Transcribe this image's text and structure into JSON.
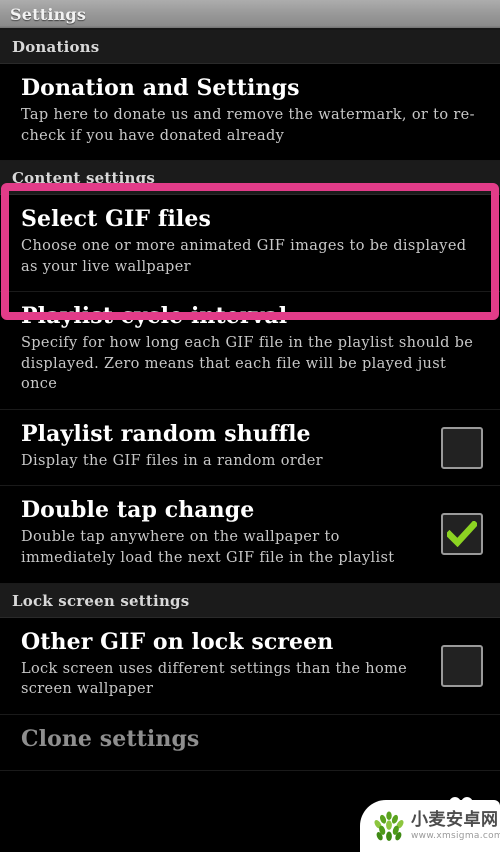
{
  "window": {
    "title": "Settings"
  },
  "colors": {
    "highlight_pink": "#e23c89",
    "checkmark_green": "#8cd322",
    "titlebar_gray": "#9a9a9a",
    "background": "#000000",
    "section_header_bg": "#1b1b1b"
  },
  "sections": [
    {
      "header": "Donations",
      "rows": [
        {
          "title": "Donation and Settings",
          "summary": "Tap here to donate us and remove the watermark, or to re-check if you have donated already",
          "checkbox": null
        }
      ]
    },
    {
      "header": "Content settings",
      "rows": [
        {
          "title": "Select GIF files",
          "summary": "Choose one or more animated GIF images to be displayed as your live wallpaper",
          "checkbox": null
        },
        {
          "title": "Playlist cycle interval",
          "summary": "Specify for how long each GIF file in the playlist should be displayed. Zero means that each file will be played just once",
          "checkbox": null
        },
        {
          "title": "Playlist random shuffle",
          "summary": "Display the GIF files in a random order",
          "checkbox": "unchecked"
        },
        {
          "title": "Double tap change",
          "summary": "Double tap anywhere on the wallpaper to immediately load the next GIF file in the playlist",
          "checkbox": "checked"
        }
      ]
    },
    {
      "header": "Lock screen settings",
      "rows": [
        {
          "title": "Other GIF on lock screen",
          "summary": "Lock screen uses different settings than the home screen wallpaper",
          "checkbox": "unchecked"
        },
        {
          "title": "Clone settings",
          "summary": "",
          "checkbox": null
        }
      ]
    }
  ],
  "highlight": {
    "target_row_title": "Select GIF files"
  },
  "watermark": {
    "brand_cn": "小麦安卓网",
    "url": "www.xmsigma.com"
  }
}
